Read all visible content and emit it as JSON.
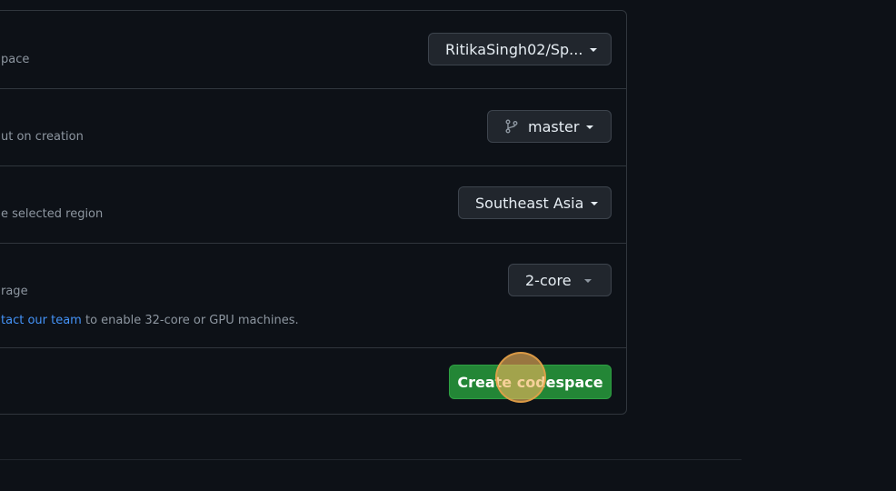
{
  "repository": {
    "description": "pace",
    "selected": "RitikaSingh02/Sp..."
  },
  "branch": {
    "description": "ut on creation",
    "selected": "master"
  },
  "region": {
    "description": "e selected region",
    "selected": "Southeast Asia"
  },
  "machine": {
    "description": "rage",
    "selected": "2-core",
    "note_link": "tact our team",
    "note_text": " to enable 32-core or GPU machines."
  },
  "actions": {
    "create_label": "Create codespace"
  },
  "colors": {
    "primary_button": "#238636",
    "link": "#4493f8",
    "background": "#0d1117"
  },
  "icons": {
    "branch": "git-branch-icon",
    "dropdown": "caret-down-icon"
  }
}
